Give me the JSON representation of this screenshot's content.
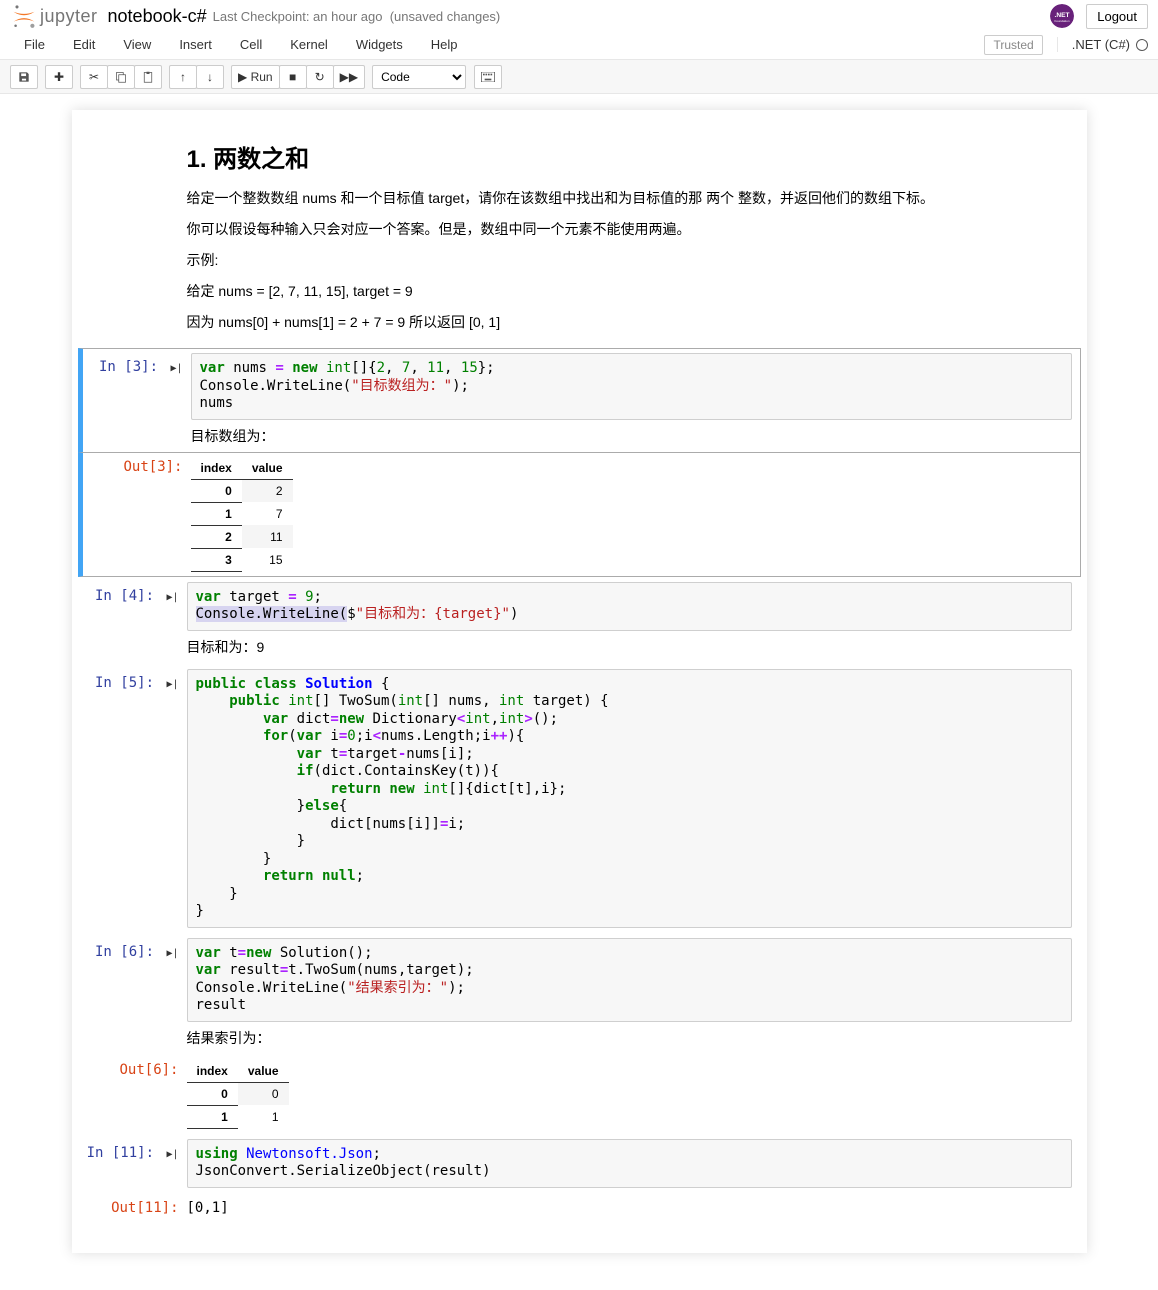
{
  "header": {
    "brand": "jupyter",
    "notebook_name": "notebook-c#",
    "checkpoint": "Last Checkpoint: an hour ago",
    "save_status": "(unsaved changes)",
    "logout": "Logout"
  },
  "menubar": {
    "items": [
      "File",
      "Edit",
      "View",
      "Insert",
      "Cell",
      "Kernel",
      "Widgets",
      "Help"
    ],
    "trusted": "Trusted",
    "kernel": ".NET (C#)"
  },
  "toolbar": {
    "run_label": "Run",
    "cell_type": "Code"
  },
  "markdown": {
    "title": "1. 两数之和",
    "p1": "给定一个整数数组 nums 和一个目标值 target，请你在该数组中找出和为目标值的那 两个 整数，并返回他们的数组下标。",
    "p2": "你可以假设每种输入只会对应一个答案。但是，数组中同一个元素不能使用两遍。",
    "p3": "示例:",
    "p4": "给定 nums = [2, 7, 11, 15], target = 9",
    "p5": "因为 nums[0] + nums[1] = 2 + 7 = 9 所以返回 [0, 1]"
  },
  "cells": {
    "c3": {
      "in_label": "In [3]:",
      "out_label": "Out[3]:",
      "stdout": "目标数组为：",
      "table": {
        "headers": [
          "index",
          "value"
        ],
        "rows": [
          [
            "0",
            "2"
          ],
          [
            "1",
            "7"
          ],
          [
            "2",
            "11"
          ],
          [
            "3",
            "15"
          ]
        ]
      }
    },
    "c4": {
      "in_label": "In [4]:",
      "stdout": "目标和为：9"
    },
    "c5": {
      "in_label": "In [5]:"
    },
    "c6": {
      "in_label": "In [6]:",
      "out_label": "Out[6]:",
      "stdout": "结果索引为：",
      "table": {
        "headers": [
          "index",
          "value"
        ],
        "rows": [
          [
            "0",
            "0"
          ],
          [
            "1",
            "1"
          ]
        ]
      }
    },
    "c11": {
      "in_label": "In [11]:",
      "out_label": "Out[11]:",
      "result": "[0,1]"
    }
  }
}
